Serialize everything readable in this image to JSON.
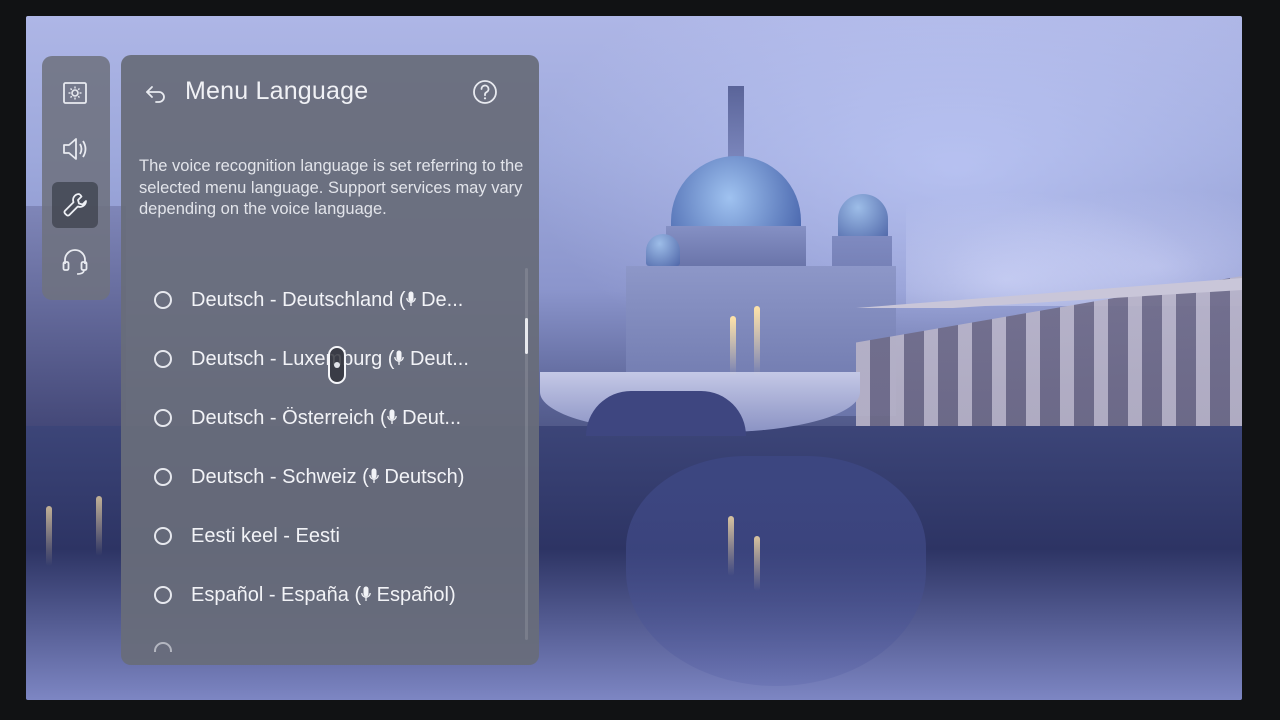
{
  "side_rail": {
    "items": [
      {
        "icon": "picture-settings-icon",
        "active": false
      },
      {
        "icon": "sound-icon",
        "active": false
      },
      {
        "icon": "wrench-icon",
        "active": true
      },
      {
        "icon": "headset-support-icon",
        "active": false
      }
    ]
  },
  "panel": {
    "title": "Menu Language",
    "back_icon": "back-arrow-icon",
    "help_icon": "help-icon",
    "description": "The voice recognition language is set referring to the selected menu language. Support services may vary depending on the voice language."
  },
  "languages": [
    {
      "name": "Deutsch - Deutschland (",
      "voice": "De..."
    },
    {
      "name": "Deutsch - Luxemburg (",
      "voice": "Deut..."
    },
    {
      "name": "Deutsch - Österreich (",
      "voice": "Deut..."
    },
    {
      "name": "Deutsch - Schweiz (",
      "voice": "Deutsch)"
    },
    {
      "name": "Eesti keel - Eesti",
      "voice": ""
    },
    {
      "name": "Español - España (",
      "voice": "Español)"
    }
  ],
  "scroll": {
    "position_fraction": 0.15
  },
  "colors": {
    "panel_bg": "#686c7a",
    "text": "#f2f3f7",
    "rail_active": "#464a56"
  }
}
